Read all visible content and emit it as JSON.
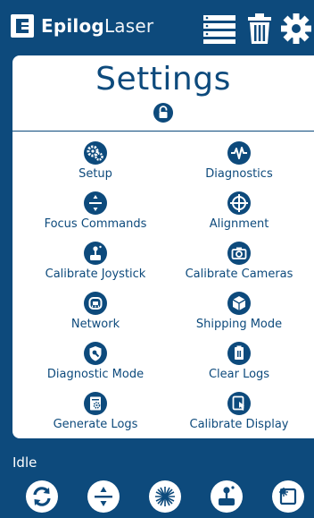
{
  "header": {
    "brand_bold": "Epilog",
    "brand_light": "Laser",
    "icons": [
      "job-list-icon",
      "trash-icon",
      "gear-icon"
    ]
  },
  "page": {
    "title": "Settings"
  },
  "settings": {
    "setup": "Setup",
    "diagnostics": "Diagnostics",
    "focus_commands": "Focus Commands",
    "alignment": "Alignment",
    "calibrate_joystick": "Calibrate Joystick",
    "calibrate_cameras": "Calibrate Cameras",
    "network": "Network",
    "shipping_mode": "Shipping Mode",
    "diagnostic_mode": "Diagnostic Mode",
    "clear_logs": "Clear Logs",
    "generate_logs": "Generate Logs",
    "calibrate_display": "Calibrate Display"
  },
  "status": {
    "text": "Idle"
  },
  "bottom_bar": {
    "icons": [
      "refresh-icon",
      "focus-icon",
      "laser-icon",
      "joystick-icon",
      "frame-icon"
    ]
  },
  "colors": {
    "brand": "#0d4a7c",
    "background": "#ffffff"
  }
}
